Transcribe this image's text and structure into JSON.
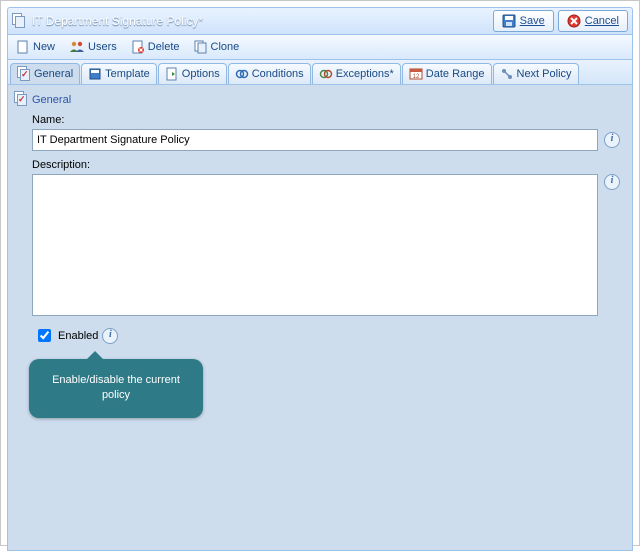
{
  "window": {
    "title": "IT Department Signature Policy*"
  },
  "titleButtons": {
    "save": "Save",
    "cancel": "Cancel"
  },
  "toolbar": {
    "new": "New",
    "users": "Users",
    "delete": "Delete",
    "clone": "Clone"
  },
  "tabs": {
    "general": "General",
    "template": "Template",
    "options": "Options",
    "conditions": "Conditions",
    "exceptions": "Exceptions*",
    "dateRange": "Date Range",
    "nextPolicy": "Next Policy"
  },
  "section": {
    "header": "General",
    "nameLabel": "Name:",
    "nameValue": "IT Department Signature Policy",
    "descriptionLabel": "Description:",
    "descriptionValue": "",
    "enabledLabel": "Enabled"
  },
  "tooltip": {
    "text": "Enable/disable the current policy"
  }
}
